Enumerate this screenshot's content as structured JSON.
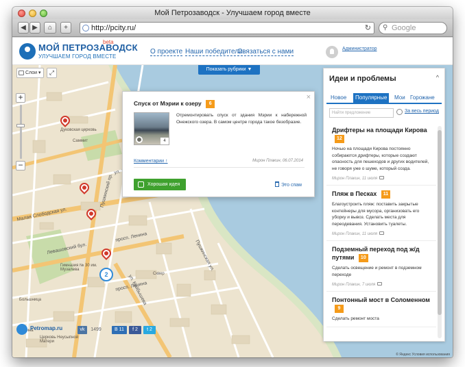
{
  "browser": {
    "window_title": "Мой Петрозаводск - Улучшаем город вместе",
    "url": "http://pcity.ru/",
    "search_placeholder": "Google"
  },
  "header": {
    "logo_title": "МОЙ ПЕТРОЗАВОДСК",
    "logo_badge": "beta",
    "logo_subtitle": "УЛУЧШАЕМ ГОРОД ВМЕСТЕ",
    "nav": [
      "О проекте",
      "Наши победители",
      "Связаться с нами"
    ],
    "admin_label": "Администратор"
  },
  "map": {
    "rubrics_button": "Показать рубрики",
    "layers_label": "Слои",
    "zoom_plus": "+",
    "zoom_minus": "−",
    "cluster_count": "2",
    "place_labels": [
      "Дуковская церковь",
      "Саммит",
      "Пушкинский пр.",
      "Малая Слободская ул.",
      "ул. Кирова",
      "Левашовский бул.",
      "ул. Энгельса",
      "Гимназия № 30 им. Музалева",
      "просп. Ленина",
      "ул. Куйбышева",
      "Пушкинская ул.",
      "Ленина",
      "ул. Гоголя",
      "Церковь Неусыпной Матери",
      "Большница",
      "Сквер",
      "ул. Крупской"
    ],
    "colors": {
      "water": "#a9cbe0",
      "land": "#ede4cf",
      "road_major": "#f3c574",
      "road_minor": "#ffffff",
      "park": "#c8dcaa",
      "building": "#e2d6bc",
      "accent_blue": "#1d72c2",
      "pin_red": "#d1392b"
    }
  },
  "popup": {
    "title": "Спуск от Мэрии к озеру",
    "votes": "6",
    "photo_count": "4",
    "description": "Отремонтировать спуск от здания Мэрии к набережной Онежского озера. В самом центре города такое безобразие.",
    "comments_link": "Комментарии ↑",
    "meta": "Мирон Плакин, 06.07.2014",
    "good_idea_button": "Хорошая идея",
    "spam_button": "Это спам",
    "close_icon": "×"
  },
  "sidebar": {
    "title": "Идеи и проблемы",
    "collapse_icon": "^",
    "tabs": [
      "Новое",
      "Популярные",
      "Мои",
      "Горожане"
    ],
    "active_tab": "Популярные",
    "search_placeholder": "Найти предложение",
    "period_link": "За весь период",
    "ideas": [
      {
        "title": "Дрифтеры на площади Кирова",
        "votes": "12",
        "description": "Ночью на площади Кирова постоянно собираются дрифтеры, которые создают опасность для пешеходов и других водителей, не говоря уже о шуме, который созда.",
        "meta": "Мирон Плакин, 11 июля"
      },
      {
        "title": "Пляж в Песках",
        "votes": "11",
        "description": "Благоустроить пляж: поставить закрытые контейнеры для мусора, организовать его уборку и вывоз. Сделать места для переодевания. Установить туалеты.",
        "meta": "Мирон Плакин, 11 июля"
      },
      {
        "title": "Подземный переход под ж/д путями",
        "votes": "10",
        "description": "Сделать освещение и ремонт в подземном переходе",
        "meta": "Мирон Плакин, 7 июля"
      },
      {
        "title": "Понтонный мост в Соломенном",
        "votes": "9",
        "description": "Сделать ремонт моста",
        "meta": ""
      }
    ]
  },
  "footer": {
    "petromap_label": "Petromap.ru",
    "petromap_sub": "карта ремонтных работ",
    "vk_count": "1499",
    "b_count": "11",
    "f_count": "2",
    "t_count": "2",
    "copyright": "© Яндекс Условия использования"
  }
}
